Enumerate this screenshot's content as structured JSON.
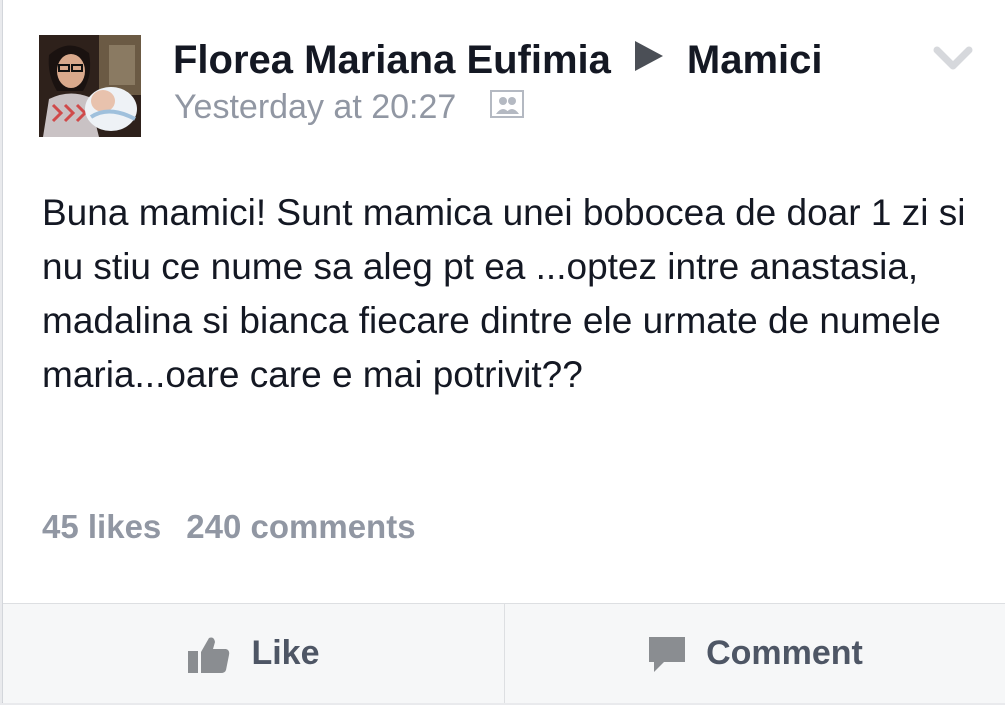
{
  "post": {
    "author": "Florea Mariana Eufimia",
    "group": "Mamici",
    "timestamp": "Yesterday at 20:27",
    "privacy_icon": "group-privacy-icon",
    "menu_icon": "chevron-down-icon",
    "text": "Buna mamici! Sunt mamica unei bobocea de doar 1 zi si nu stiu ce nume sa aleg pt ea ...optez intre anastasia, madalina si bianca fiecare dintre ele urmate de numele maria...oare care e mai potrivit??",
    "likes": "45 likes",
    "comments": "240 comments"
  },
  "actions": {
    "like_label": "Like",
    "comment_label": "Comment"
  },
  "colors": {
    "text": "#141823",
    "secondary": "#9197a3",
    "action_text": "#4e5665"
  }
}
